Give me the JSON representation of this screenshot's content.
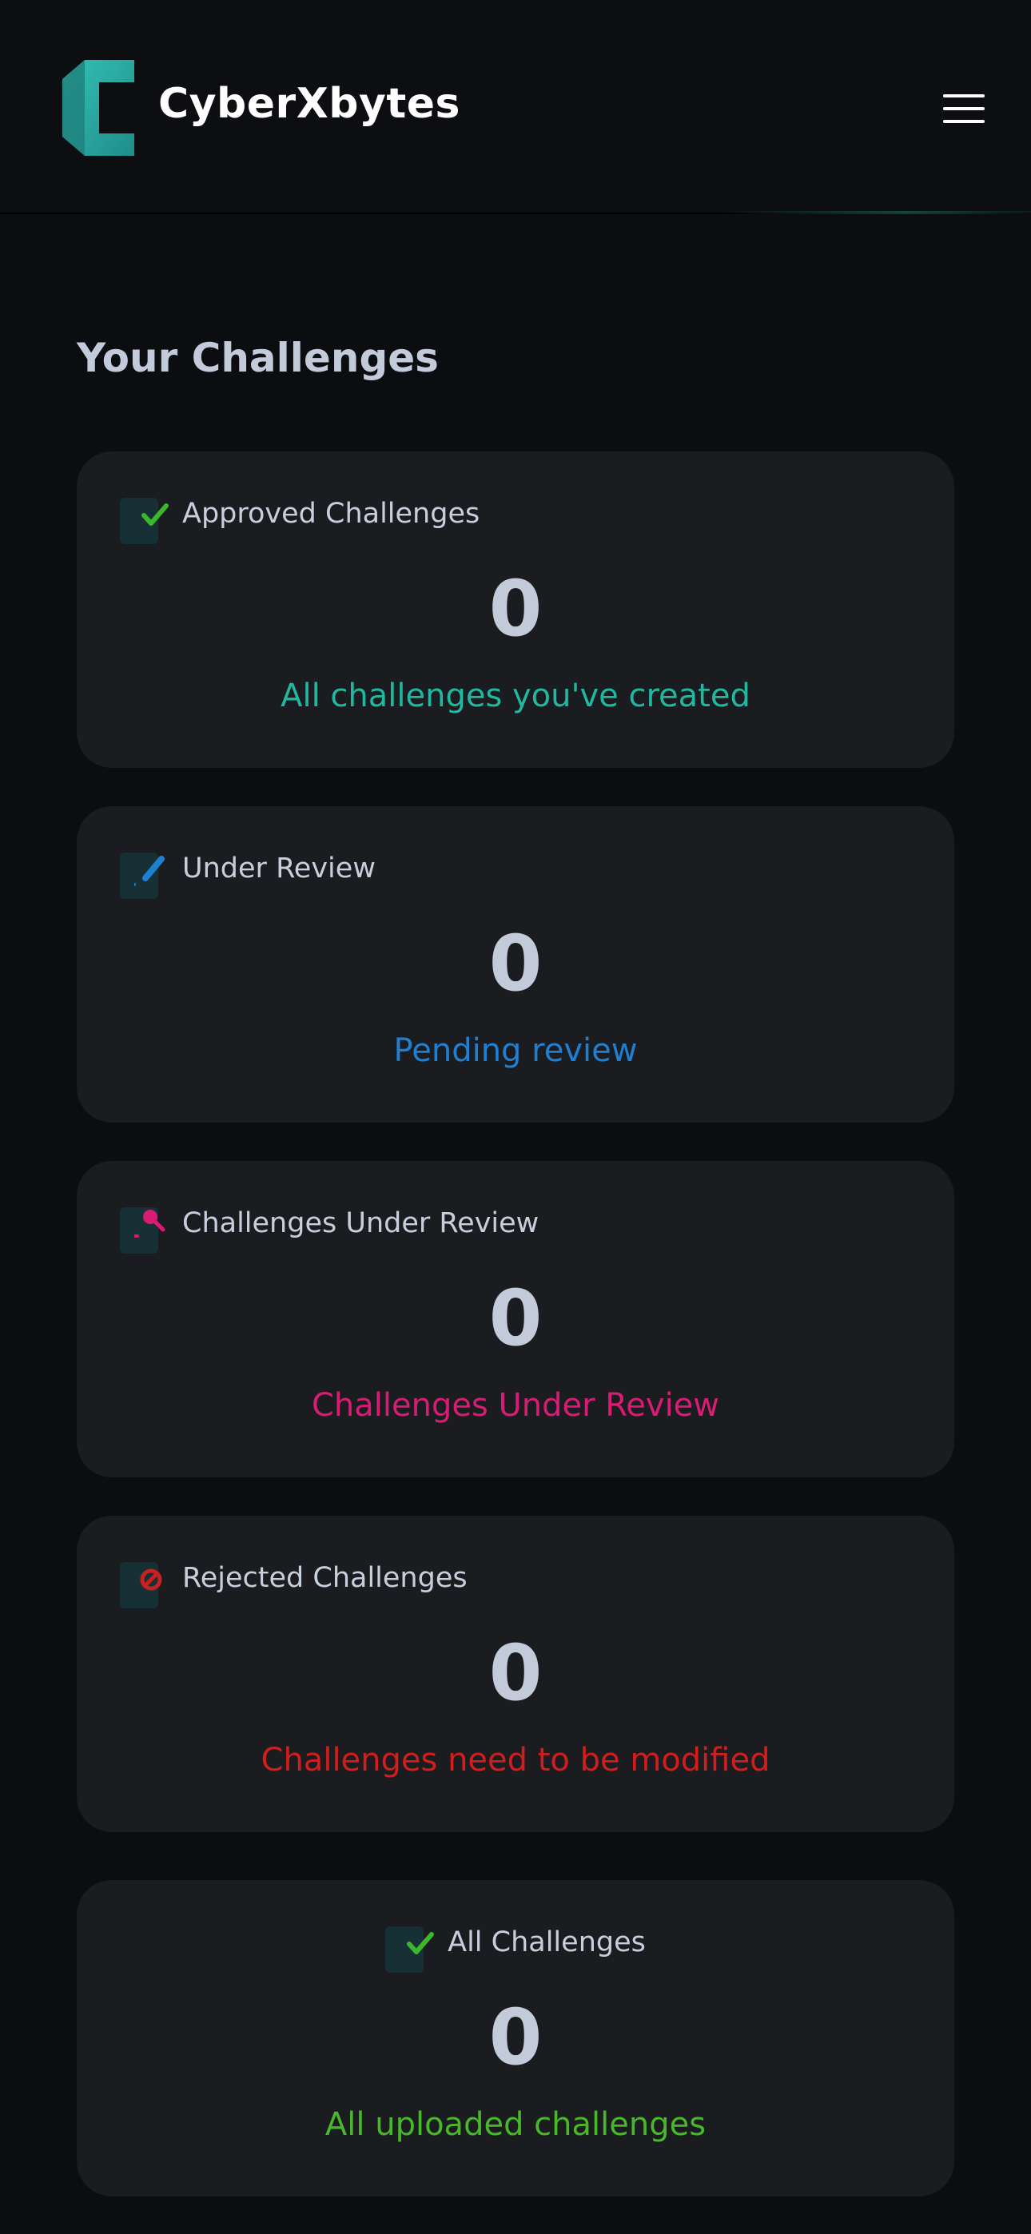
{
  "header": {
    "brand": "CyberXbytes",
    "logo_color": "#2aa8a0"
  },
  "section": {
    "title": "Your Challenges"
  },
  "cards": [
    {
      "label": "Approved Challenges",
      "value": "0",
      "subtitle": "All challenges you've created",
      "subtitle_color": "#20b8a0",
      "icon": "approved-check-icon",
      "icon_color": "#3cb62c"
    },
    {
      "label": "Under Review",
      "value": "0",
      "subtitle": "Pending review",
      "subtitle_color": "#1f7fd1",
      "icon": "edit-pen-icon",
      "icon_color": "#1f7fd1"
    },
    {
      "label": "Challenges Under Review",
      "value": "0",
      "subtitle": "Challenges Under Review",
      "subtitle_color": "#d81b73",
      "icon": "magnifier-icon",
      "icon_color": "#d81b73"
    },
    {
      "label": "Rejected Challenges",
      "value": "0",
      "subtitle": "Challenges need to be modified",
      "subtitle_color": "#d31c1c",
      "icon": "rejected-ban-icon",
      "icon_color": "#c62020"
    },
    {
      "label": "All Challenges",
      "value": "0",
      "subtitle": "All uploaded challenges",
      "subtitle_color": "#46b82a",
      "icon": "all-check-icon",
      "icon_color": "#3cb62c"
    }
  ]
}
